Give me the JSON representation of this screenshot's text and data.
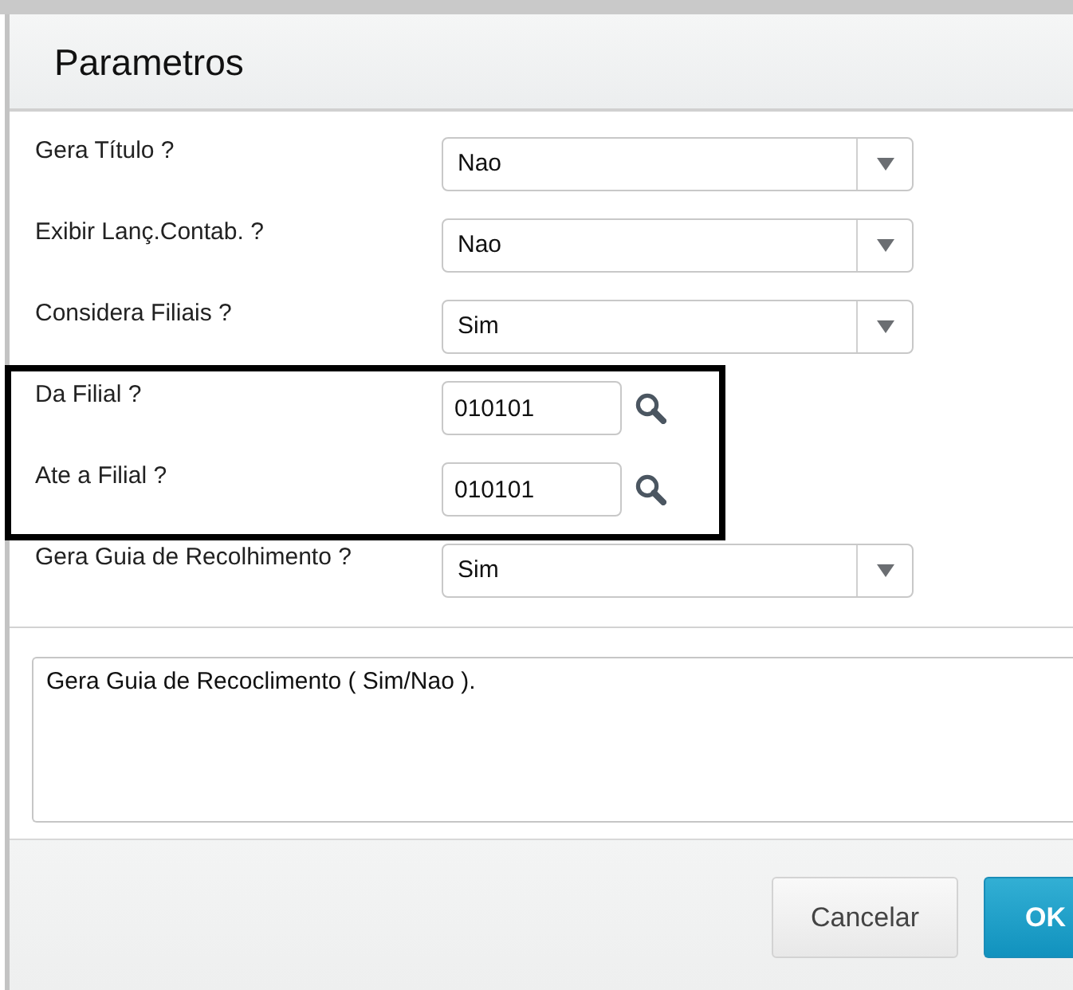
{
  "dialog": {
    "title": "Parametros"
  },
  "parameters": [
    {
      "label": "Gera Título ?",
      "kind": "select",
      "value": "Nao",
      "highlighted": false
    },
    {
      "label": "Exibir Lanç.Contab. ?",
      "kind": "select",
      "value": "Nao",
      "highlighted": false
    },
    {
      "label": "Considera Filiais ?",
      "kind": "select",
      "value": "Sim",
      "highlighted": false
    },
    {
      "label": "Da Filial ?",
      "kind": "lookup",
      "value": "010101",
      "highlighted": true
    },
    {
      "label": "Ate a Filial ?",
      "kind": "lookup",
      "value": "010101",
      "highlighted": true
    },
    {
      "label": "Gera Guia de Recolhimento ?",
      "kind": "select",
      "value": "Sim",
      "highlighted": false
    }
  ],
  "help_text": "Gera Guia de Recoclimento ( Sim/Nao ).",
  "buttons": [
    {
      "label": "Cancelar",
      "kind": "secondary"
    },
    {
      "label": "OK",
      "kind": "primary"
    }
  ]
}
